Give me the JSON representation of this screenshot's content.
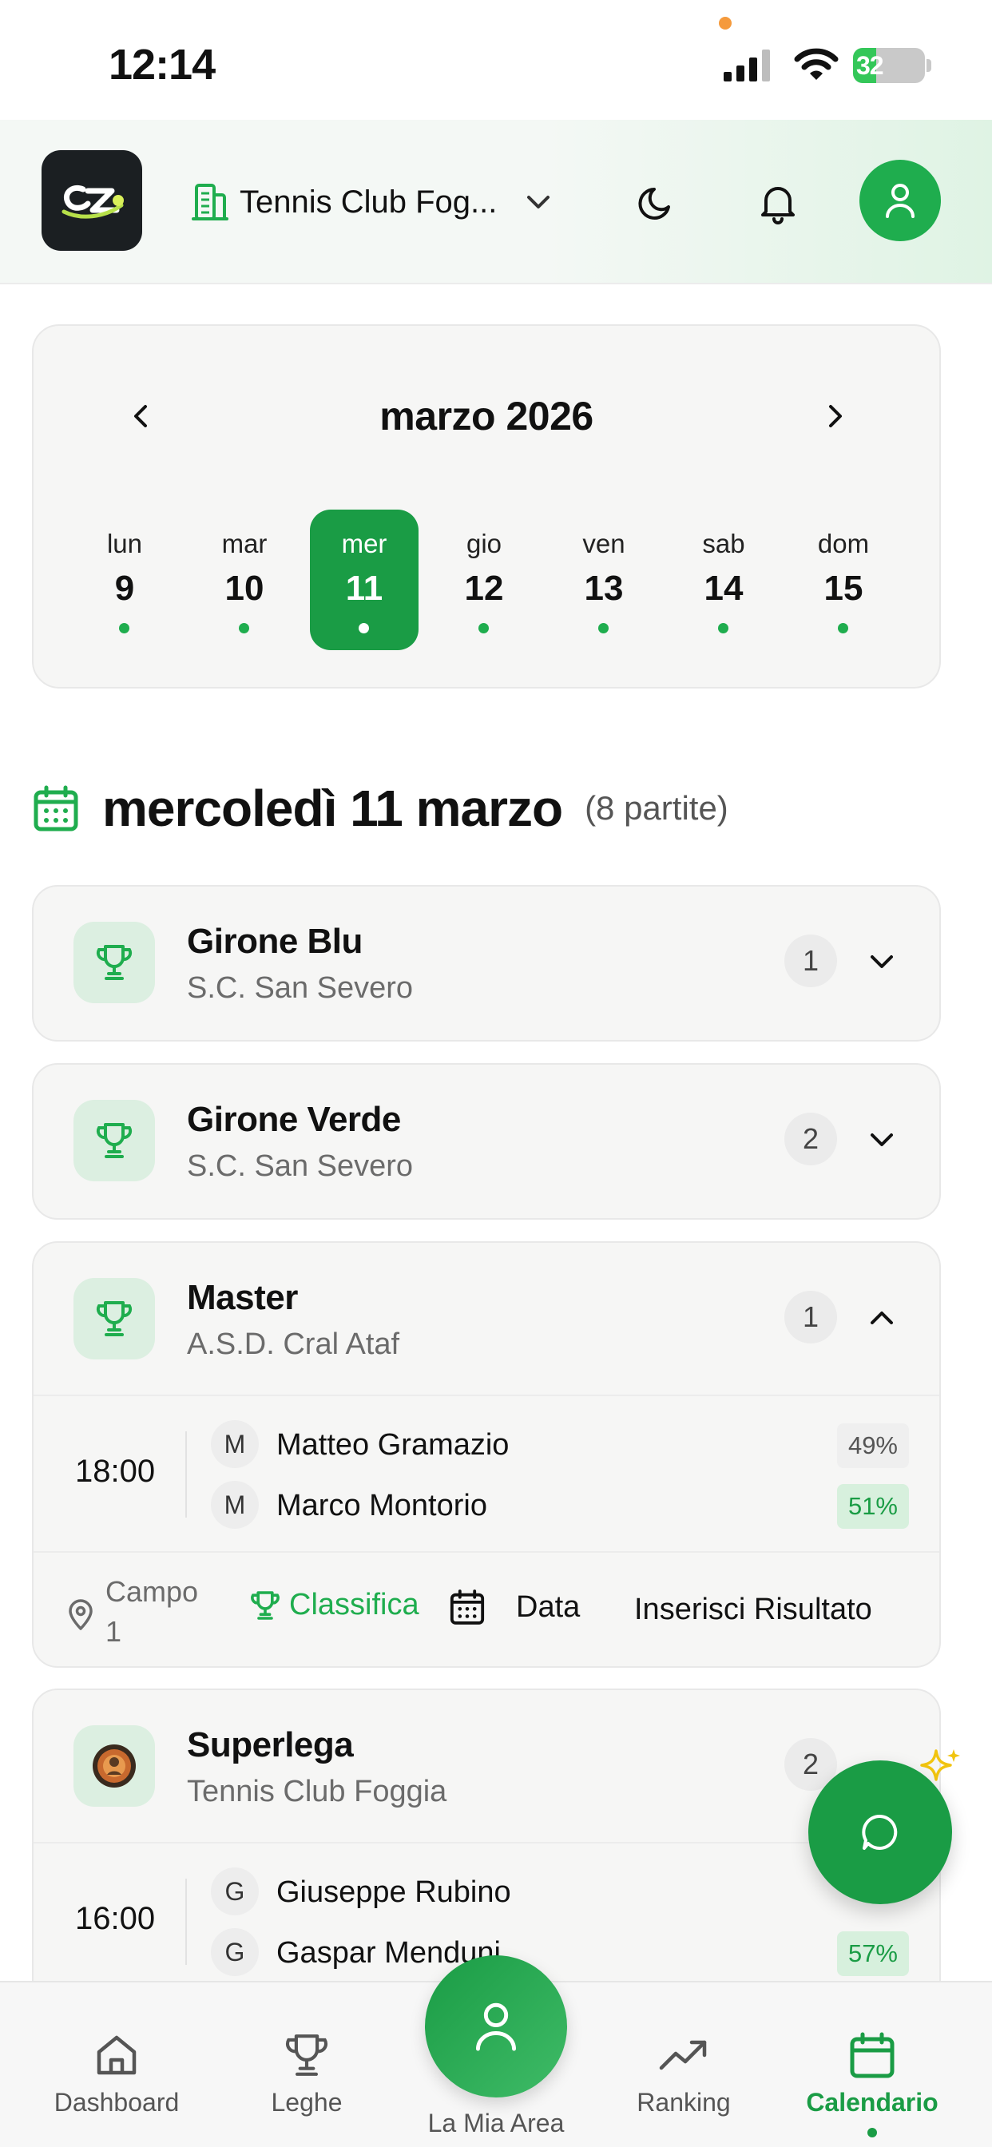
{
  "status_bar": {
    "time": "12:14",
    "battery": "32",
    "battery_level": 0.32
  },
  "header": {
    "club_name": "Tennis Club Fog..."
  },
  "calendar": {
    "month_title": "marzo 2026",
    "days": [
      {
        "name": "lun",
        "num": "9"
      },
      {
        "name": "mar",
        "num": "10"
      },
      {
        "name": "mer",
        "num": "11",
        "active": true
      },
      {
        "name": "gio",
        "num": "12"
      },
      {
        "name": "ven",
        "num": "13"
      },
      {
        "name": "sab",
        "num": "14"
      },
      {
        "name": "dom",
        "num": "15"
      }
    ]
  },
  "day_heading": {
    "title": "mercoledì 11 marzo",
    "count": "(8 partite)"
  },
  "leagues": [
    {
      "name": "Girone Blu",
      "club": "S.C. San Severo",
      "count": "1",
      "expanded": false
    },
    {
      "name": "Girone Verde",
      "club": "S.C. San Severo",
      "count": "2",
      "expanded": false
    },
    {
      "name": "Master",
      "club": "A.S.D. Cral Ataf",
      "count": "1",
      "expanded": true,
      "match": {
        "time": "18:00",
        "players": [
          {
            "initial": "M",
            "name": "Matteo Gramazio",
            "pct": "49%"
          },
          {
            "initial": "M",
            "name": "Marco Montorio",
            "pct": "51%"
          }
        ],
        "campo": "Campo 1",
        "classifica": "Classifica",
        "data": "Data",
        "inserisci": "Inserisci Risultato"
      }
    },
    {
      "name": "Superlega",
      "club": "Tennis Club Foggia",
      "count": "2",
      "expanded": true,
      "match": {
        "time": "16:00",
        "players": [
          {
            "initial": "G",
            "name": "Giuseppe Rubino",
            "pct": ""
          },
          {
            "initial": "G",
            "name": "Gaspar Menduni",
            "pct": "57%"
          }
        ]
      }
    }
  ],
  "bottom_nav": {
    "dashboard": "Dashboard",
    "leghe": "Leghe",
    "mia_area": "La Mia Area",
    "ranking": "Ranking",
    "calendario": "Calendario"
  },
  "colors": {
    "accent": "#1a9c45",
    "accent_light": "#1fad4e",
    "card_bg": "#f6f6f5"
  },
  "icons": [
    "signal-icon",
    "wifi-icon",
    "building-icon",
    "chevron-down-icon",
    "moon-icon",
    "bell-icon",
    "user-icon",
    "chevron-left-icon",
    "chevron-right-icon",
    "calendar-icon",
    "trophy-icon",
    "chevron-up-icon",
    "location-pin-icon",
    "chat-icon",
    "sparkle-icon",
    "home-icon",
    "trending-up-icon"
  ]
}
